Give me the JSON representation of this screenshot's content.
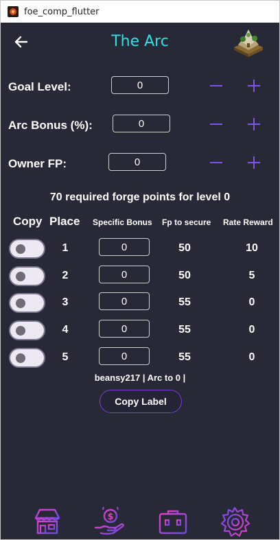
{
  "window": {
    "title": "foe_comp_flutter"
  },
  "appbar": {
    "title": "The Arc",
    "back_icon": "arrow-back-icon",
    "logo": "great-building-logo"
  },
  "fields": [
    {
      "label": "Goal Level:",
      "value": "0"
    },
    {
      "label": "Arc Bonus (%):",
      "value": "0"
    },
    {
      "label": "Owner FP:",
      "value": "0"
    }
  ],
  "summary": "70 required forge points for level 0",
  "table": {
    "headers": {
      "copy": "Copy",
      "place": "Place",
      "bonus": "Specific Bonus",
      "fp": "Fp to secure",
      "reward": "Rate Reward"
    },
    "rows": [
      {
        "place": "1",
        "bonus": "0",
        "fp": "50",
        "reward": "10"
      },
      {
        "place": "2",
        "bonus": "0",
        "fp": "50",
        "reward": "5"
      },
      {
        "place": "3",
        "bonus": "0",
        "fp": "55",
        "reward": "0"
      },
      {
        "place": "4",
        "bonus": "0",
        "fp": "55",
        "reward": "0"
      },
      {
        "place": "5",
        "bonus": "0",
        "fp": "55",
        "reward": "0"
      }
    ]
  },
  "label_text": "beansy217 | Arc to 0 |",
  "copy_button": "Copy Label",
  "nav": [
    "town-hall-icon",
    "money-hand-icon",
    "toolbox-icon",
    "settings-gear-icon"
  ],
  "colors": {
    "background": "#272a36",
    "title": "#2fe0e6",
    "accent": "#7b3fd6",
    "nav_pink": "#e040c8",
    "nav_purple": "#6a4ce0"
  }
}
